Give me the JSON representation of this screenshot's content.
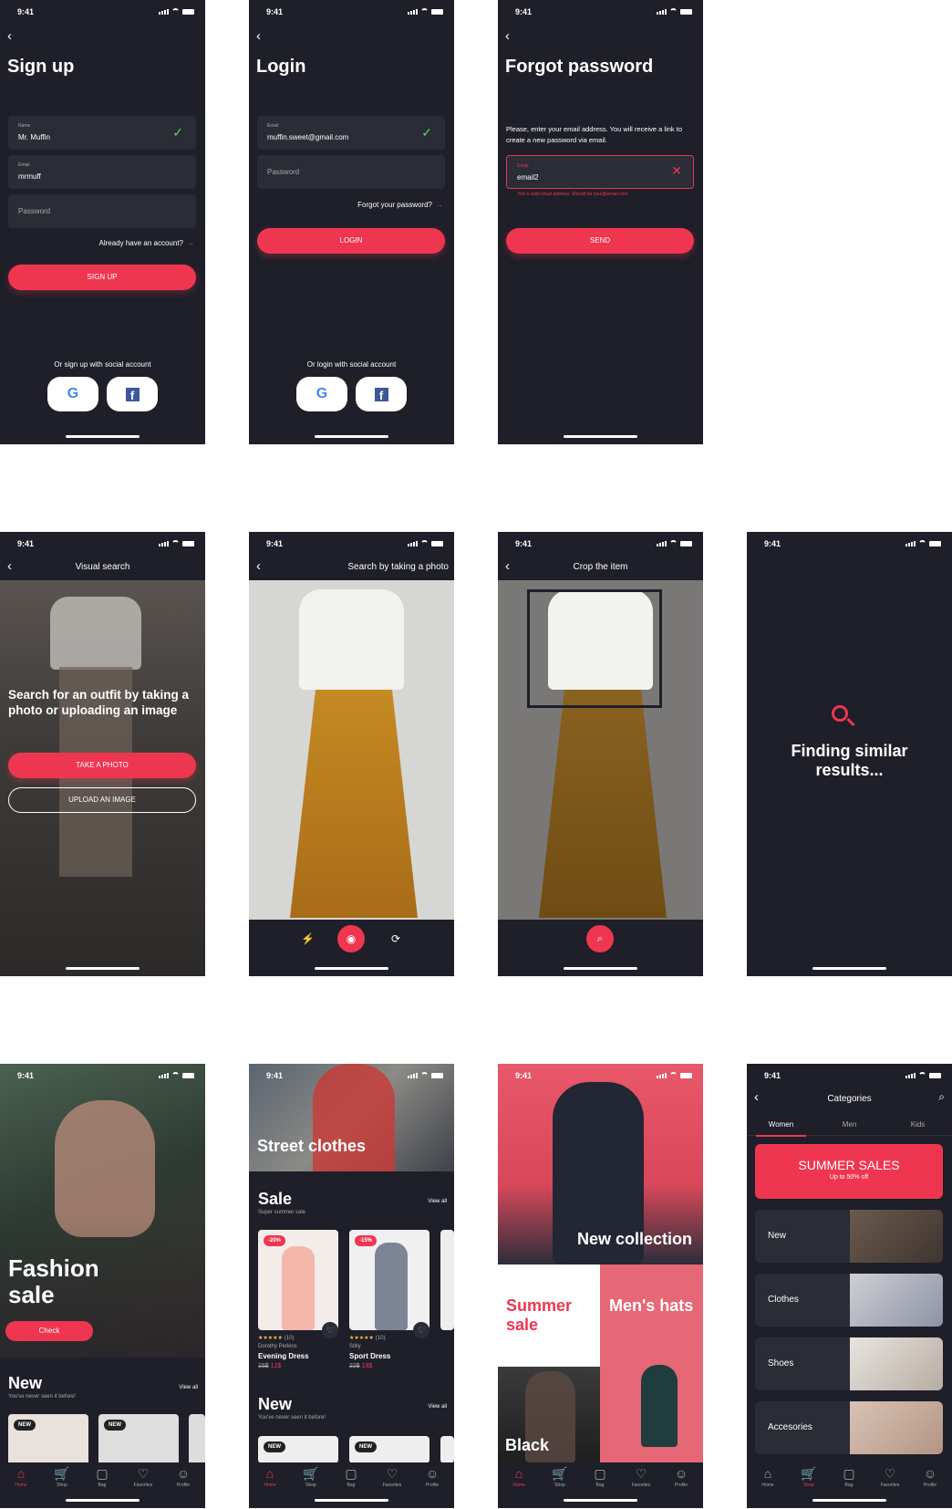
{
  "status": {
    "time": "9:41"
  },
  "signup": {
    "title": "Sign up",
    "name_label": "Name",
    "name_value": "Mr. Muffin",
    "email_label": "Email",
    "email_value": "mrmuff",
    "password_placeholder": "Password",
    "have_account": "Already have an account?",
    "button": "SIGN UP",
    "social_text": "Or sign up with social account"
  },
  "login": {
    "title": "Login",
    "email_label": "Email",
    "email_value": "muffin.sweet@gmail.com",
    "password_placeholder": "Password",
    "forgot": "Forgot your password?",
    "button": "LOGIN",
    "social_text": "Or login with social account"
  },
  "forgot": {
    "title": "Forgot password",
    "description": "Please, enter your email address. You will receive a link to create a new password via email.",
    "email_label": "Email",
    "email_value": "email2",
    "error": "Not a valid email address. Should be your@email.com",
    "button": "SEND"
  },
  "visual_search": {
    "title": "Visual search",
    "headline": "Search for an outfit by taking a photo or uploading an image",
    "take_photo": "TAKE A PHOTO",
    "upload": "UPLOAD AN IMAGE"
  },
  "photo_search": {
    "title": "Search by taking a photo"
  },
  "crop": {
    "title": "Crop the item"
  },
  "finding": {
    "text": "Finding similar results..."
  },
  "home1": {
    "headline": "Fashion sale",
    "button": "Check",
    "new_title": "New",
    "new_sub": "You've never seen it before!",
    "view_all": "View all",
    "badge": "NEW"
  },
  "home2": {
    "banner": "Street clothes",
    "sale_title": "Sale",
    "sale_sub": "Super summer sale",
    "view_all": "View all",
    "products": [
      {
        "badge": "-20%",
        "reviews": "(10)",
        "brand": "Dorothy Perkins",
        "name": "Evening Dress",
        "old_price": "15$",
        "new_price": "12$"
      },
      {
        "badge": "-15%",
        "reviews": "(10)",
        "brand": "Sitlly",
        "name": "Sport Dress",
        "old_price": "22$",
        "new_price": "19$"
      }
    ],
    "new_title": "New",
    "new_sub": "You've never seen it before!",
    "badge": "NEW"
  },
  "home3": {
    "collection": "New collection",
    "summer": "Summer sale",
    "hats": "Men's hats",
    "black": "Black"
  },
  "categories": {
    "title": "Categories",
    "tabs": [
      "Women",
      "Men",
      "Kids"
    ],
    "promo_title": "SUMMER SALES",
    "promo_sub": "Up to 50% off",
    "items": [
      "New",
      "Clothes",
      "Shoes",
      "Accesories"
    ]
  },
  "nav": [
    "Home",
    "Shop",
    "Bag",
    "Favorites",
    "Profile"
  ],
  "colors": {
    "accent": "#ef3651",
    "bg": "#1e1f28",
    "field": "#2a2c36",
    "success": "#55d85a"
  }
}
